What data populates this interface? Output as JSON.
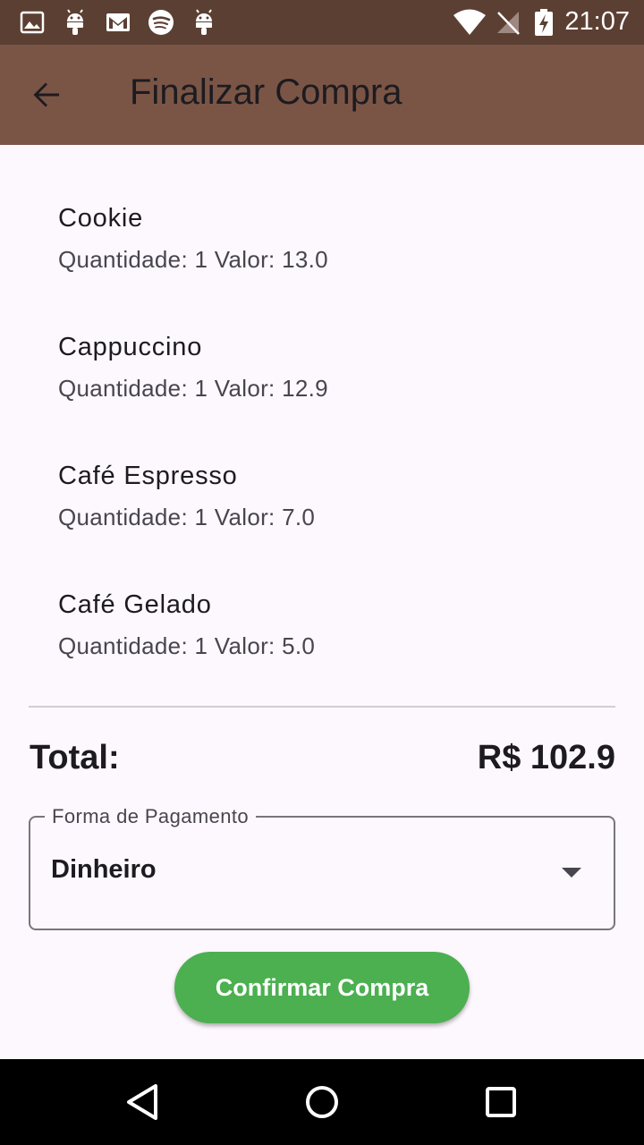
{
  "status_bar": {
    "time": "21:07",
    "left_icons": [
      "image-icon",
      "android-icon",
      "gmail-icon",
      "spotify-icon",
      "android-icon"
    ],
    "right_icons": [
      "wifi-icon",
      "no-signal-icon",
      "battery-charging-icon"
    ]
  },
  "app_bar": {
    "title": "Finalizar Compra",
    "back_icon": "arrow-back-icon",
    "background": "#7a5546"
  },
  "items": [
    {
      "name": "Cookie",
      "detail": "Quantidade: 1 Valor: 13.0"
    },
    {
      "name": "Cappuccino",
      "detail": "Quantidade: 1 Valor: 12.9"
    },
    {
      "name": "Café Espresso",
      "detail": "Quantidade: 1 Valor: 7.0"
    },
    {
      "name": "Café Gelado",
      "detail": "Quantidade: 1 Valor: 5.0"
    }
  ],
  "total": {
    "label": "Total:",
    "value": "R$ 102.9"
  },
  "payment": {
    "label": "Forma de Pagamento",
    "selected": "Dinheiro",
    "dropdown_icon": "arrow-drop-down-icon"
  },
  "confirm_button": {
    "label": "Confirmar Compra",
    "color": "#4caf50"
  },
  "nav_bar": {
    "icons": [
      "back-triangle-icon",
      "home-circle-icon",
      "recents-square-icon"
    ]
  }
}
